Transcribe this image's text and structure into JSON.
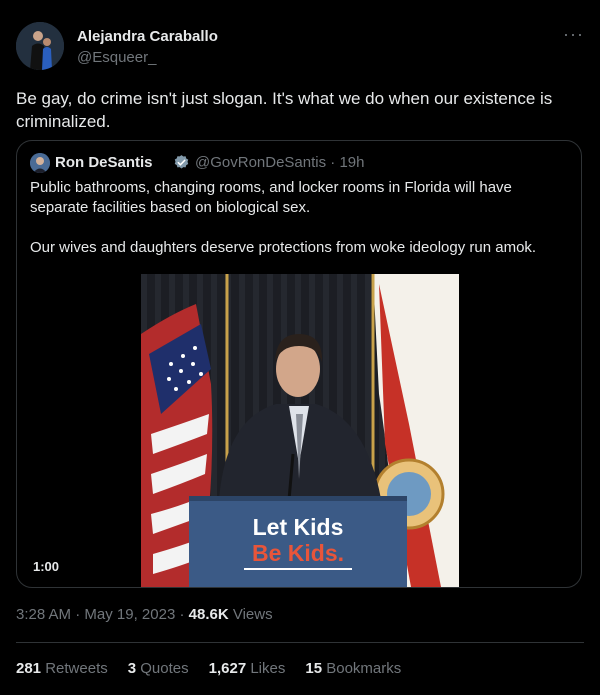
{
  "tweet": {
    "author_name": "Alejandra Caraballo",
    "author_handle": "@Esqueer_",
    "more_icon": "ellipsis-icon",
    "text": "Be gay, do crime isn't just slogan. It's what we do when our existence is criminalized."
  },
  "quoted": {
    "author_name": "Ron DeSantis",
    "verified_icon": "verified-badge-icon",
    "author_handle": "@GovRonDeSantis",
    "separator": "·",
    "time": "19h",
    "paragraphs": [
      "Public bathrooms, changing rooms, and locker rooms in Florida will have separate facilities based on biological sex.",
      "Our wives and daughters deserve protections from woke ideology run amok."
    ],
    "video": {
      "duration": "1:00",
      "podium_line1": "Let Kids",
      "podium_line2": "Be Kids."
    }
  },
  "meta": {
    "time": "3:28 AM",
    "separator1": "·",
    "date": "May 19, 2023",
    "separator2": "·",
    "views_count": "48.6K",
    "views_label": "Views"
  },
  "stats": [
    {
      "count": "281",
      "label": "Retweets"
    },
    {
      "count": "3",
      "label": "Quotes"
    },
    {
      "count": "1,627",
      "label": "Likes"
    },
    {
      "count": "15",
      "label": "Bookmarks"
    }
  ],
  "colors": {
    "background": "#000000",
    "primary_text": "#e7e9ea",
    "secondary_text": "#71767b",
    "border": "#2f3336",
    "verified": "#1d9bf0",
    "podium": "#3b5a86",
    "podium_accent": "#e8553a"
  }
}
